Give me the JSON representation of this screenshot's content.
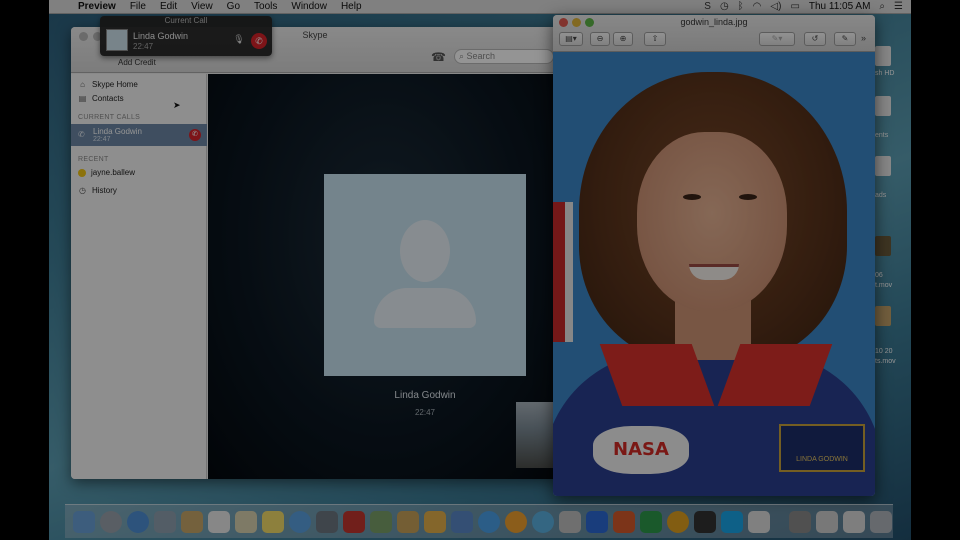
{
  "menubar": {
    "app_name": "Preview",
    "items": [
      "File",
      "Edit",
      "View",
      "Go",
      "Tools",
      "Window",
      "Help"
    ],
    "clock": "Thu 11:05 AM"
  },
  "call_popup": {
    "title": "Current Call",
    "name": "Linda Godwin",
    "time": "22:47"
  },
  "skype": {
    "title": "Skype",
    "add_credit": "Add Credit",
    "search_placeholder": "Search",
    "sidebar": {
      "skype_home": "Skype Home",
      "contacts": "Contacts",
      "current_calls_header": "CURRENT CALLS",
      "current_call": {
        "name": "Linda Godwin",
        "time": "22:47"
      },
      "recent_header": "RECENT",
      "recent_contact": "jayne.ballew",
      "history": "History"
    },
    "call": {
      "name": "Linda Godwin",
      "time": "22:47"
    }
  },
  "preview": {
    "filename": "godwin_linda.jpg",
    "photo": {
      "patch_text": "NASA",
      "name_patch": "LINDA GODWIN"
    }
  },
  "desktop": {
    "labels": [
      "sh HD",
      "ents",
      "ads",
      "06",
      "t.mov",
      "10 20",
      "ts.mov"
    ]
  },
  "colors": {
    "skype_hangup": "#d7232a",
    "sidebar_selected": "#6d87a5",
    "avatar_bg": "#c9e3f1"
  }
}
